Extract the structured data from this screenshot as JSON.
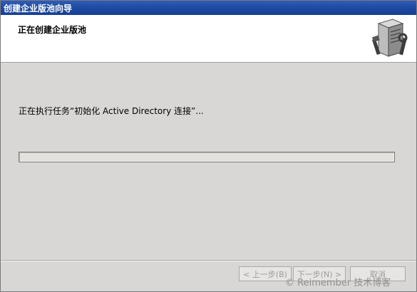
{
  "window": {
    "title": "创建企业版池向导"
  },
  "header": {
    "title": "正在创建企业版池"
  },
  "main": {
    "status_text": "正在执行任务“初始化 Active Directory 连接”...",
    "progress_fraction": 0.0
  },
  "buttons": {
    "back_label": "< 上一步(B)",
    "next_label": "下一步(N) >",
    "cancel_label": "取消"
  },
  "watermark": "© Reimember 技术博客",
  "icons": {
    "header_icon": "server-tools-icon"
  },
  "colors": {
    "title_bar": "#1f4aa0",
    "progress_fill": "#2fb44a"
  }
}
